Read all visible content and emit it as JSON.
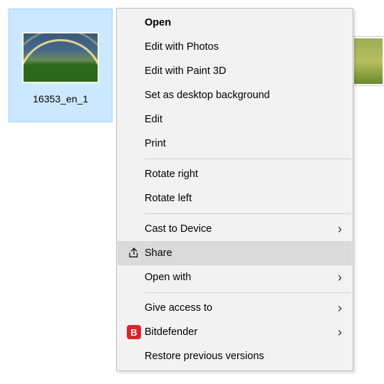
{
  "file": {
    "name": "16353_en_1"
  },
  "menu": {
    "open": "Open",
    "edit_photos": "Edit with Photos",
    "edit_paint3d": "Edit with Paint 3D",
    "set_wallpaper": "Set as desktop background",
    "edit": "Edit",
    "print": "Print",
    "rotate_right": "Rotate right",
    "rotate_left": "Rotate left",
    "cast": "Cast to Device",
    "share": "Share",
    "open_with": "Open with",
    "give_access": "Give access to",
    "bitdefender": "Bitdefender",
    "restore": "Restore previous versions"
  },
  "icons": {
    "bd_letter": "B"
  }
}
